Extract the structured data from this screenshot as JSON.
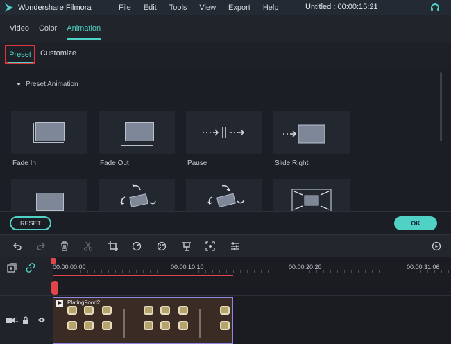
{
  "app": {
    "name": "Wondershare Filmora",
    "document_title": "Untitled : 00:00:15:21"
  },
  "menu": [
    "File",
    "Edit",
    "Tools",
    "View",
    "Export",
    "Help"
  ],
  "tabs": [
    {
      "label": "Video",
      "active": false
    },
    {
      "label": "Color",
      "active": false
    },
    {
      "label": "Animation",
      "active": true
    }
  ],
  "subtabs": {
    "preset": "Preset",
    "customize": "Customize"
  },
  "preset_section": {
    "title": "Preset Animation"
  },
  "presets": [
    {
      "label": "Fade In",
      "icon": "fade-in-icon"
    },
    {
      "label": "Fade Out",
      "icon": "fade-out-icon"
    },
    {
      "label": "Pause",
      "icon": "pause-icon"
    },
    {
      "label": "Slide Right",
      "icon": "slide-right-icon"
    },
    {
      "label": "",
      "icon": "slide-icon"
    },
    {
      "label": "",
      "icon": "rotate-left-icon"
    },
    {
      "label": "",
      "icon": "rotate-right-icon"
    },
    {
      "label": "",
      "icon": "zoom-out-icon"
    }
  ],
  "buttons": {
    "reset": "RESET",
    "ok": "OK"
  },
  "timeline": {
    "timecodes": [
      "00:00:00:00",
      "00:00:10:10",
      "00:00:20:20",
      "00:00:31:06"
    ],
    "clip_name": "PlatingFood2",
    "track_label": "1"
  },
  "colors": {
    "accent": "#4fd1c5",
    "highlight": "#e0353c",
    "playhead": "#e0454b",
    "clip_border": "#8f86e3"
  }
}
